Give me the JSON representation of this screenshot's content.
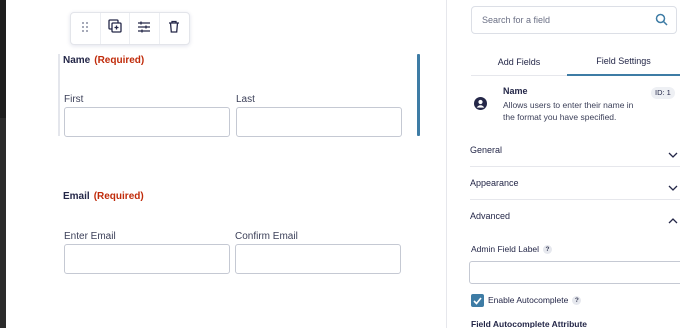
{
  "toolbar": {
    "icons": [
      "drag-handle-icon",
      "duplicate-icon",
      "settings-sliders-icon",
      "trash-icon"
    ]
  },
  "fields": {
    "name": {
      "label": "Name",
      "required": "(Required)",
      "first_label": "First",
      "last_label": "Last",
      "first_value": "",
      "last_value": ""
    },
    "email": {
      "label": "Email",
      "required": "(Required)",
      "enter_label": "Enter Email",
      "confirm_label": "Confirm Email",
      "enter_value": "",
      "confirm_value": ""
    }
  },
  "panel": {
    "search_placeholder": "Search for a field",
    "tabs": [
      {
        "label": "Add Fields",
        "active": false
      },
      {
        "label": "Field Settings",
        "active": true
      }
    ],
    "field_info": {
      "title": "Name",
      "description": "Allows users to enter their name in the format you have specified.",
      "id_badge": "ID: 1",
      "icon": "user-circle-icon"
    },
    "sections": [
      {
        "label": "General",
        "expanded": false
      },
      {
        "label": "Appearance",
        "expanded": false
      },
      {
        "label": "Advanced",
        "expanded": true
      }
    ],
    "admin_field_label": "Admin Field Label",
    "admin_field_value": "",
    "help_glyph": "?",
    "enable_autocomplete": {
      "label": "Enable Autocomplete",
      "checked": true
    },
    "autocomplete_attribute_label": "Field Autocomplete Attribute"
  },
  "colors": {
    "accent": "#3e7ca5",
    "required": "#c02b0a",
    "text": "#242748"
  }
}
